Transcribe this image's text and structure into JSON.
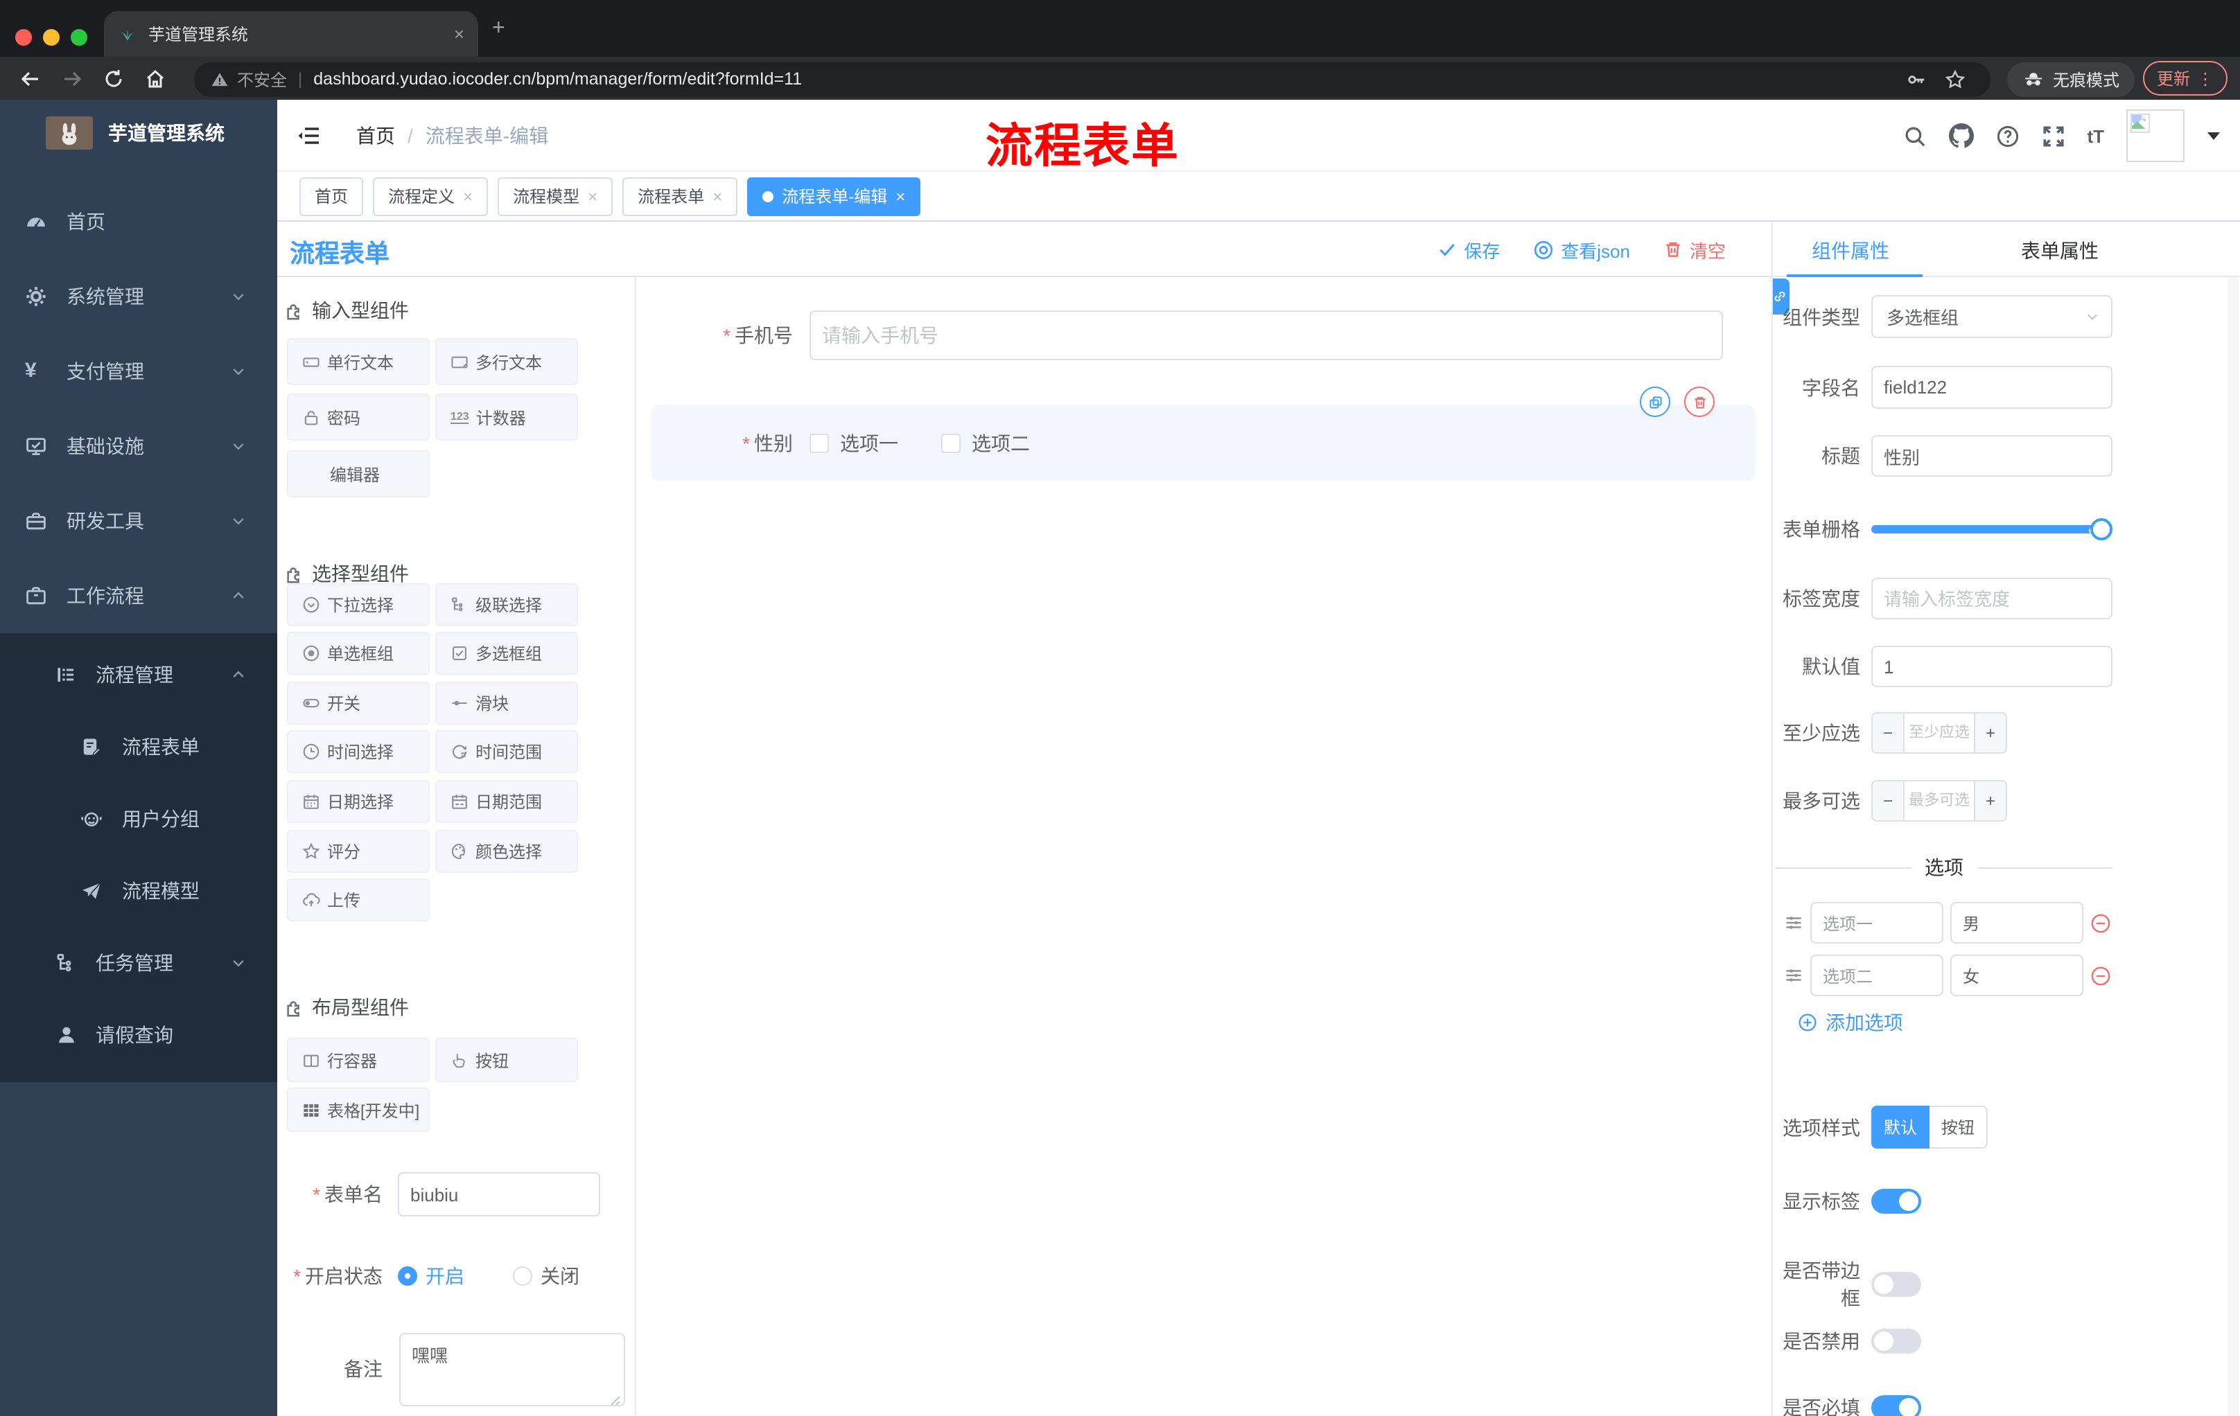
{
  "browser": {
    "tab_title": "芋道管理系统",
    "security": "不安全",
    "url": "dashboard.yudao.iocoder.cn/bpm/manager/form/edit?formId=11",
    "incognito": "无痕模式",
    "update": "更新"
  },
  "header": {
    "home": "首页",
    "current": "流程表单-编辑",
    "annotation": "流程表单"
  },
  "tagbar": {
    "tabs": [
      {
        "label": "首页"
      },
      {
        "label": "流程定义"
      },
      {
        "label": "流程模型"
      },
      {
        "label": "流程表单"
      },
      {
        "label": "流程表单-编辑"
      }
    ]
  },
  "sidebar": {
    "title": "芋道管理系统",
    "menu": [
      {
        "label": "首页",
        "icon": "dashboard-icon"
      },
      {
        "label": "系统管理",
        "icon": "gear-icon"
      },
      {
        "label": "支付管理",
        "icon": "yen-icon"
      },
      {
        "label": "基础设施",
        "icon": "monitor-icon"
      },
      {
        "label": "研发工具",
        "icon": "toolbox-icon"
      },
      {
        "label": "工作流程",
        "icon": "briefcase-icon"
      },
      {
        "label": "流程管理",
        "icon": "list-icon"
      },
      {
        "label": "流程表单",
        "icon": "document-edit-icon"
      },
      {
        "label": "用户分组",
        "icon": "robot-icon"
      },
      {
        "label": "流程模型",
        "icon": "paper-plane-icon"
      },
      {
        "label": "任务管理",
        "icon": "tree-icon"
      },
      {
        "label": "请假查询",
        "icon": "user-icon"
      }
    ]
  },
  "page": {
    "title": "流程表单",
    "save": "保存",
    "view_json": "查看json",
    "clear": "清空"
  },
  "palette": {
    "sections": [
      {
        "title": "输入型组件",
        "items": [
          {
            "label": "单行文本",
            "icon": "text-field-icon"
          },
          {
            "label": "多行文本",
            "icon": "textarea-icon"
          },
          {
            "label": "密码",
            "icon": "lock-icon"
          },
          {
            "label": "计数器",
            "icon": "counter-icon"
          },
          {
            "label": "编辑器",
            "icon": "none"
          }
        ]
      },
      {
        "title": "选择型组件",
        "items": [
          {
            "label": "下拉选择",
            "icon": "select-icon"
          },
          {
            "label": "级联选择",
            "icon": "cascader-icon"
          },
          {
            "label": "单选框组",
            "icon": "radio-icon"
          },
          {
            "label": "多选框组",
            "icon": "checkbox-icon"
          },
          {
            "label": "开关",
            "icon": "switch-icon"
          },
          {
            "label": "滑块",
            "icon": "slider-icon"
          },
          {
            "label": "时间选择",
            "icon": "clock-icon"
          },
          {
            "label": "时间范围",
            "icon": "clock-range-icon"
          },
          {
            "label": "日期选择",
            "icon": "calendar-icon"
          },
          {
            "label": "日期范围",
            "icon": "calendar-range-icon"
          },
          {
            "label": "评分",
            "icon": "star-icon"
          },
          {
            "label": "颜色选择",
            "icon": "palette-icon"
          },
          {
            "label": "上传",
            "icon": "upload-icon"
          }
        ]
      },
      {
        "title": "布局型组件",
        "items": [
          {
            "label": "行容器",
            "icon": "columns-icon"
          },
          {
            "label": "按钮",
            "icon": "pointer-icon"
          },
          {
            "label": "表格[开发中]",
            "icon": "table-icon"
          }
        ]
      }
    ]
  },
  "canvas": {
    "phone": {
      "label": "手机号",
      "placeholder": "请输入手机号"
    },
    "gender": {
      "label": "性别",
      "opt1": "选项一",
      "opt2": "选项二"
    }
  },
  "meta": {
    "form_name": {
      "label": "表单名",
      "value": "biubiu"
    },
    "status": {
      "label": "开启状态",
      "on": "开启",
      "off": "关闭"
    },
    "remark": {
      "label": "备注",
      "value": "嘿嘿"
    }
  },
  "inspector": {
    "tab_component": "组件属性",
    "tab_form": "表单属性",
    "component_type": {
      "label": "组件类型",
      "value": "多选框组"
    },
    "field_name": {
      "label": "字段名",
      "value": "field122"
    },
    "title": {
      "label": "标题",
      "value": "性别"
    },
    "grid": {
      "label": "表单栅格"
    },
    "label_width": {
      "label": "标签宽度",
      "placeholder": "请输入标签宽度"
    },
    "default_value": {
      "label": "默认值",
      "value": "1"
    },
    "min_select": {
      "label": "至少应选",
      "placeholder": "至少应选"
    },
    "max_select": {
      "label": "最多可选",
      "placeholder": "最多可选"
    },
    "options": {
      "title": "选项",
      "rows": [
        {
          "name": "选项一",
          "value": "男"
        },
        {
          "name": "选项二",
          "value": "女"
        }
      ],
      "add": "添加选项"
    },
    "option_style": {
      "label": "选项样式",
      "default": "默认",
      "button": "按钮"
    },
    "show_label": {
      "label": "显示标签"
    },
    "bordered": {
      "label": "是否带边框"
    },
    "disabled": {
      "label": "是否禁用"
    },
    "required": {
      "label": "是否必填"
    }
  },
  "colors": {
    "accent": "#409eff",
    "danger": "#f56c6c",
    "sidebar": "#304156",
    "submenu": "#1f2d3d",
    "annotation": "#fe0000"
  }
}
